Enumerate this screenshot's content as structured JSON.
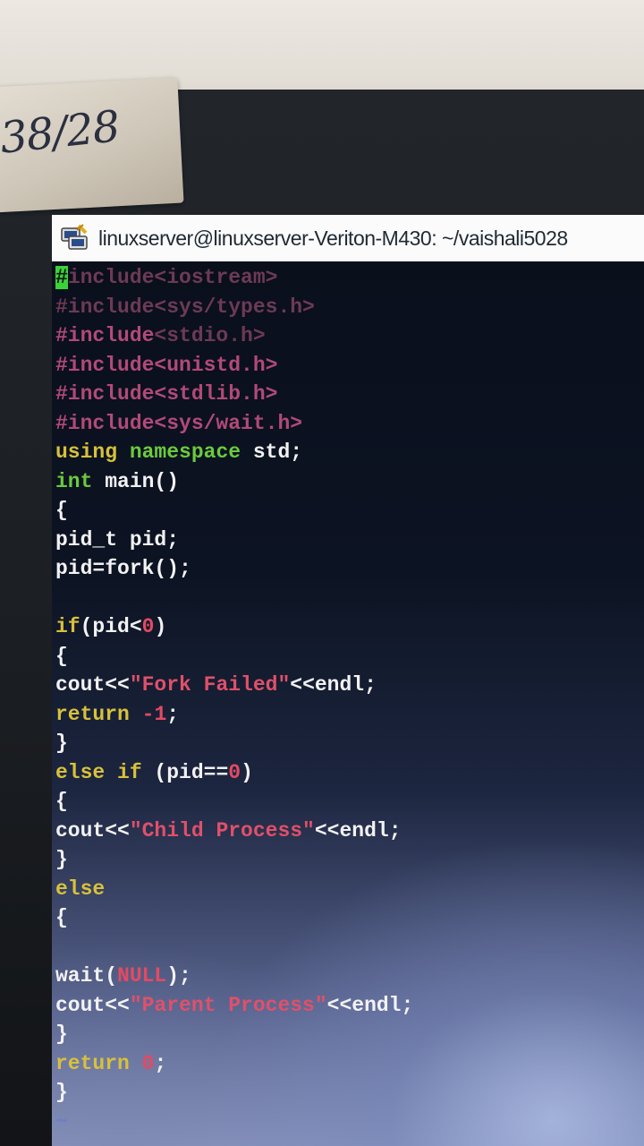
{
  "sticky_note": {
    "text": "38/28"
  },
  "window": {
    "title": "linuxserver@linuxserver-Veriton-M430: ~/vaishali5028",
    "icon": "putty-terminal-icon"
  },
  "editor": {
    "lines": [
      {
        "parts": [
          {
            "t": "#",
            "c": "cursor"
          },
          {
            "t": "include<iostream>",
            "c": "ppdim"
          }
        ]
      },
      {
        "parts": [
          {
            "t": "#include<sys/types.h>",
            "c": "ppdim"
          }
        ]
      },
      {
        "parts": [
          {
            "t": "#include",
            "c": "pp"
          },
          {
            "t": "<stdio.h>",
            "c": "ppdim"
          }
        ]
      },
      {
        "parts": [
          {
            "t": "#include",
            "c": "pp"
          },
          {
            "t": "<unistd.h>",
            "c": "pp"
          }
        ]
      },
      {
        "parts": [
          {
            "t": "#include",
            "c": "pp"
          },
          {
            "t": "<stdlib.h>",
            "c": "pp"
          }
        ]
      },
      {
        "parts": [
          {
            "t": "#include",
            "c": "pp"
          },
          {
            "t": "<sys/wait.h>",
            "c": "pp"
          }
        ]
      },
      {
        "parts": [
          {
            "t": "using",
            "c": "kw"
          },
          {
            "t": " ",
            "c": ""
          },
          {
            "t": "namespace",
            "c": "grn"
          },
          {
            "t": " std;",
            "c": ""
          }
        ]
      },
      {
        "parts": [
          {
            "t": "int",
            "c": "grn"
          },
          {
            "t": " main()",
            "c": ""
          }
        ]
      },
      {
        "parts": [
          {
            "t": "{",
            "c": ""
          }
        ]
      },
      {
        "parts": [
          {
            "t": "pid_t pid;",
            "c": ""
          }
        ]
      },
      {
        "parts": [
          {
            "t": "pid=fork();",
            "c": ""
          }
        ]
      },
      {
        "parts": [
          {
            "t": "",
            "c": ""
          }
        ]
      },
      {
        "parts": [
          {
            "t": "if",
            "c": "kw"
          },
          {
            "t": "(pid<",
            "c": ""
          },
          {
            "t": "0",
            "c": "num"
          },
          {
            "t": ")",
            "c": ""
          }
        ]
      },
      {
        "parts": [
          {
            "t": "{",
            "c": ""
          }
        ]
      },
      {
        "parts": [
          {
            "t": "cout<<",
            "c": ""
          },
          {
            "t": "\"Fork Failed\"",
            "c": "str"
          },
          {
            "t": "<<endl;",
            "c": ""
          }
        ]
      },
      {
        "parts": [
          {
            "t": "return",
            "c": "kw"
          },
          {
            "t": " ",
            "c": ""
          },
          {
            "t": "-1",
            "c": "num"
          },
          {
            "t": ";",
            "c": ""
          }
        ]
      },
      {
        "parts": [
          {
            "t": "}",
            "c": ""
          }
        ]
      },
      {
        "parts": [
          {
            "t": "else if",
            "c": "kw"
          },
          {
            "t": " (pid==",
            "c": ""
          },
          {
            "t": "0",
            "c": "num"
          },
          {
            "t": ")",
            "c": ""
          }
        ]
      },
      {
        "parts": [
          {
            "t": "{",
            "c": ""
          }
        ]
      },
      {
        "parts": [
          {
            "t": "cout<<",
            "c": ""
          },
          {
            "t": "\"Child Process\"",
            "c": "str"
          },
          {
            "t": "<<endl;",
            "c": ""
          }
        ]
      },
      {
        "parts": [
          {
            "t": "}",
            "c": ""
          }
        ]
      },
      {
        "parts": [
          {
            "t": "else",
            "c": "kw"
          }
        ]
      },
      {
        "parts": [
          {
            "t": "{",
            "c": ""
          }
        ]
      },
      {
        "parts": [
          {
            "t": "",
            "c": ""
          }
        ]
      },
      {
        "parts": [
          {
            "t": "wait(",
            "c": ""
          },
          {
            "t": "NULL",
            "c": "num"
          },
          {
            "t": ");",
            "c": ""
          }
        ]
      },
      {
        "parts": [
          {
            "t": "cout<<",
            "c": ""
          },
          {
            "t": "\"Parent Process\"",
            "c": "str"
          },
          {
            "t": "<<endl;",
            "c": ""
          }
        ]
      },
      {
        "parts": [
          {
            "t": "}",
            "c": ""
          }
        ]
      },
      {
        "parts": [
          {
            "t": "return",
            "c": "kw"
          },
          {
            "t": " ",
            "c": ""
          },
          {
            "t": "0",
            "c": "num"
          },
          {
            "t": ";",
            "c": ""
          }
        ]
      },
      {
        "parts": [
          {
            "t": "}",
            "c": ""
          }
        ]
      },
      {
        "parts": [
          {
            "t": "~",
            "c": "tilde"
          }
        ]
      },
      {
        "parts": [
          {
            "t": "~",
            "c": "tilde"
          }
        ]
      },
      {
        "parts": [
          {
            "t": "~",
            "c": "tilde"
          }
        ]
      }
    ]
  }
}
